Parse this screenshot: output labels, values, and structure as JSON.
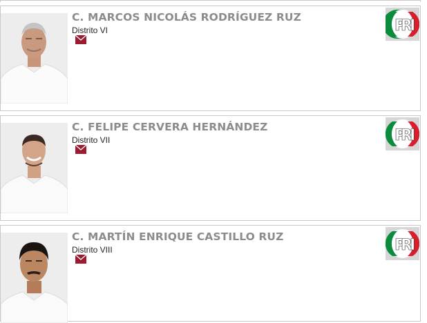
{
  "deputies": [
    {
      "name": "C. MARCOS NICOLÁS RODRÍGUEZ RUZ",
      "district": "Distrito VI",
      "party": "PRI"
    },
    {
      "name": "C. FELIPE CERVERA HERNÁNDEZ",
      "district": "Distrito VII",
      "party": "PRI"
    },
    {
      "name": "C. MARTÍN ENRIQUE CASTILLO RUZ",
      "district": "Distrito VIII",
      "party": "PRI"
    }
  ],
  "colors": {
    "name_text": "#8c8c8c",
    "mail_icon": "#9b1b30",
    "pri_green": "#0a8c3c",
    "pri_red": "#d81e2c",
    "card_border": "#c8c8c8"
  },
  "icons": {
    "mail": "envelope-icon",
    "party_logo": "pri-logo"
  }
}
